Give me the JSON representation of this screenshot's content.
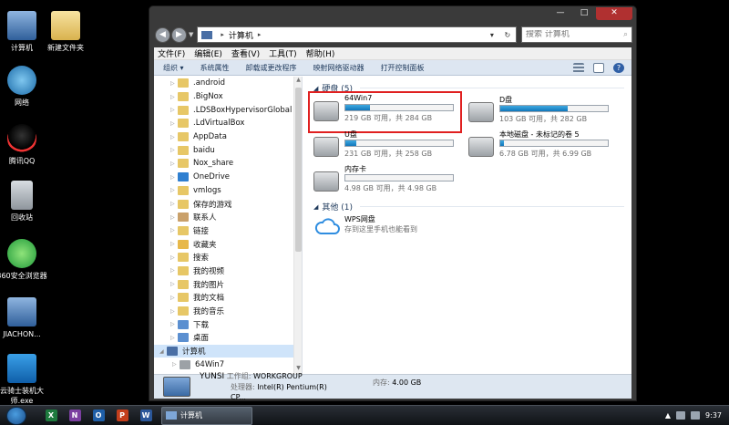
{
  "desktop": {
    "icons": [
      {
        "label": "计算机",
        "icon": "computer-icon"
      },
      {
        "label": "新建文件夹",
        "icon": "folder-icon"
      },
      {
        "label": "网络",
        "icon": "network-icon"
      },
      {
        "label": "腾讯QQ",
        "icon": "qq-icon"
      },
      {
        "label": "回收站",
        "icon": "recycle-bin-icon"
      },
      {
        "label": "360安全浏览器",
        "icon": "browser-360-icon"
      },
      {
        "label": "JIACHON...",
        "icon": "computer-icon"
      },
      {
        "label": "云骑士装机大师.exe",
        "icon": "installer-icon"
      }
    ]
  },
  "window": {
    "caption": {
      "minimize": "—",
      "maximize": "□",
      "close": "✕"
    },
    "address": {
      "root": "计算机",
      "sep": "▸"
    },
    "search": {
      "placeholder": "搜索 计算机"
    },
    "menu": [
      "文件(F)",
      "编辑(E)",
      "查看(V)",
      "工具(T)",
      "帮助(H)"
    ],
    "toolbar": [
      "组织 ▾",
      "系统属性",
      "卸载或更改程序",
      "映射网络驱动器",
      "打开控制面板"
    ],
    "nav": [
      {
        "label": ".android",
        "icon": "folder-icon"
      },
      {
        "label": ".BigNox",
        "icon": "folder-icon"
      },
      {
        "label": ".LDSBoxHypervisorGlobal",
        "icon": "folder-icon"
      },
      {
        "label": ".LdVirtualBox",
        "icon": "folder-icon"
      },
      {
        "label": "AppData",
        "icon": "folder-icon"
      },
      {
        "label": "baidu",
        "icon": "folder-icon"
      },
      {
        "label": "Nox_share",
        "icon": "folder-icon"
      },
      {
        "label": "OneDrive",
        "icon": "onedrive-icon"
      },
      {
        "label": "vmlogs",
        "icon": "folder-icon"
      },
      {
        "label": "保存的游戏",
        "icon": "saved-games-icon"
      },
      {
        "label": "联系人",
        "icon": "contacts-icon"
      },
      {
        "label": "链接",
        "icon": "links-icon"
      },
      {
        "label": "收藏夹",
        "icon": "favorites-icon"
      },
      {
        "label": "搜索",
        "icon": "search-folder-icon"
      },
      {
        "label": "我的视频",
        "icon": "videos-icon"
      },
      {
        "label": "我的图片",
        "icon": "pictures-icon"
      },
      {
        "label": "我的文档",
        "icon": "documents-icon"
      },
      {
        "label": "我的音乐",
        "icon": "music-icon"
      },
      {
        "label": "下载",
        "icon": "downloads-icon"
      },
      {
        "label": "桌面",
        "icon": "desktop-folder-icon"
      }
    ],
    "nav_computer": "计算机",
    "nav_sub": "64Win7",
    "hard_disks_header": "硬盘 (5)",
    "drives": [
      {
        "name": "64Win7",
        "info": "219 GB 可用，共 284 GB",
        "used": 0.23
      },
      {
        "name": "D盘",
        "info": "103 GB 可用，共 282 GB",
        "used": 0.63
      },
      {
        "name": "U盘",
        "info": "231 GB 可用，共 258 GB",
        "used": 0.1
      },
      {
        "name": "本地磁盘 - 未标记的卷 5",
        "info": "6.78 GB 可用，共 6.99 GB",
        "used": 0.03
      },
      {
        "name": "内存卡",
        "info": "4.98 GB 可用，共 4.98 GB",
        "used": 0.0
      }
    ],
    "other_header": "其他 (1)",
    "wps": {
      "name": "WPS网盘",
      "desc": "存到这里手机也能看到"
    },
    "details": {
      "name": "YUNSI",
      "workgroup_label": "工作组:",
      "workgroup": "WORKGROUP",
      "memory_label": "内存:",
      "memory": "4.00 GB",
      "cpu_label": "处理器:",
      "cpu": "Intel(R) Pentium(R) CP..."
    }
  },
  "taskbar": {
    "apps": [
      {
        "letter": "X",
        "color": "#1e7a3e",
        "icon": "excel-icon"
      },
      {
        "letter": "N",
        "color": "#7b3fa0",
        "icon": "onenote-icon"
      },
      {
        "letter": "O",
        "color": "#1f5fa8",
        "icon": "outlook-icon"
      },
      {
        "letter": "P",
        "color": "#c43e1c",
        "icon": "powerpoint-icon"
      },
      {
        "letter": "W",
        "color": "#2b579a",
        "icon": "word-icon"
      }
    ],
    "task_label": "计算机",
    "clock": "9:37"
  }
}
